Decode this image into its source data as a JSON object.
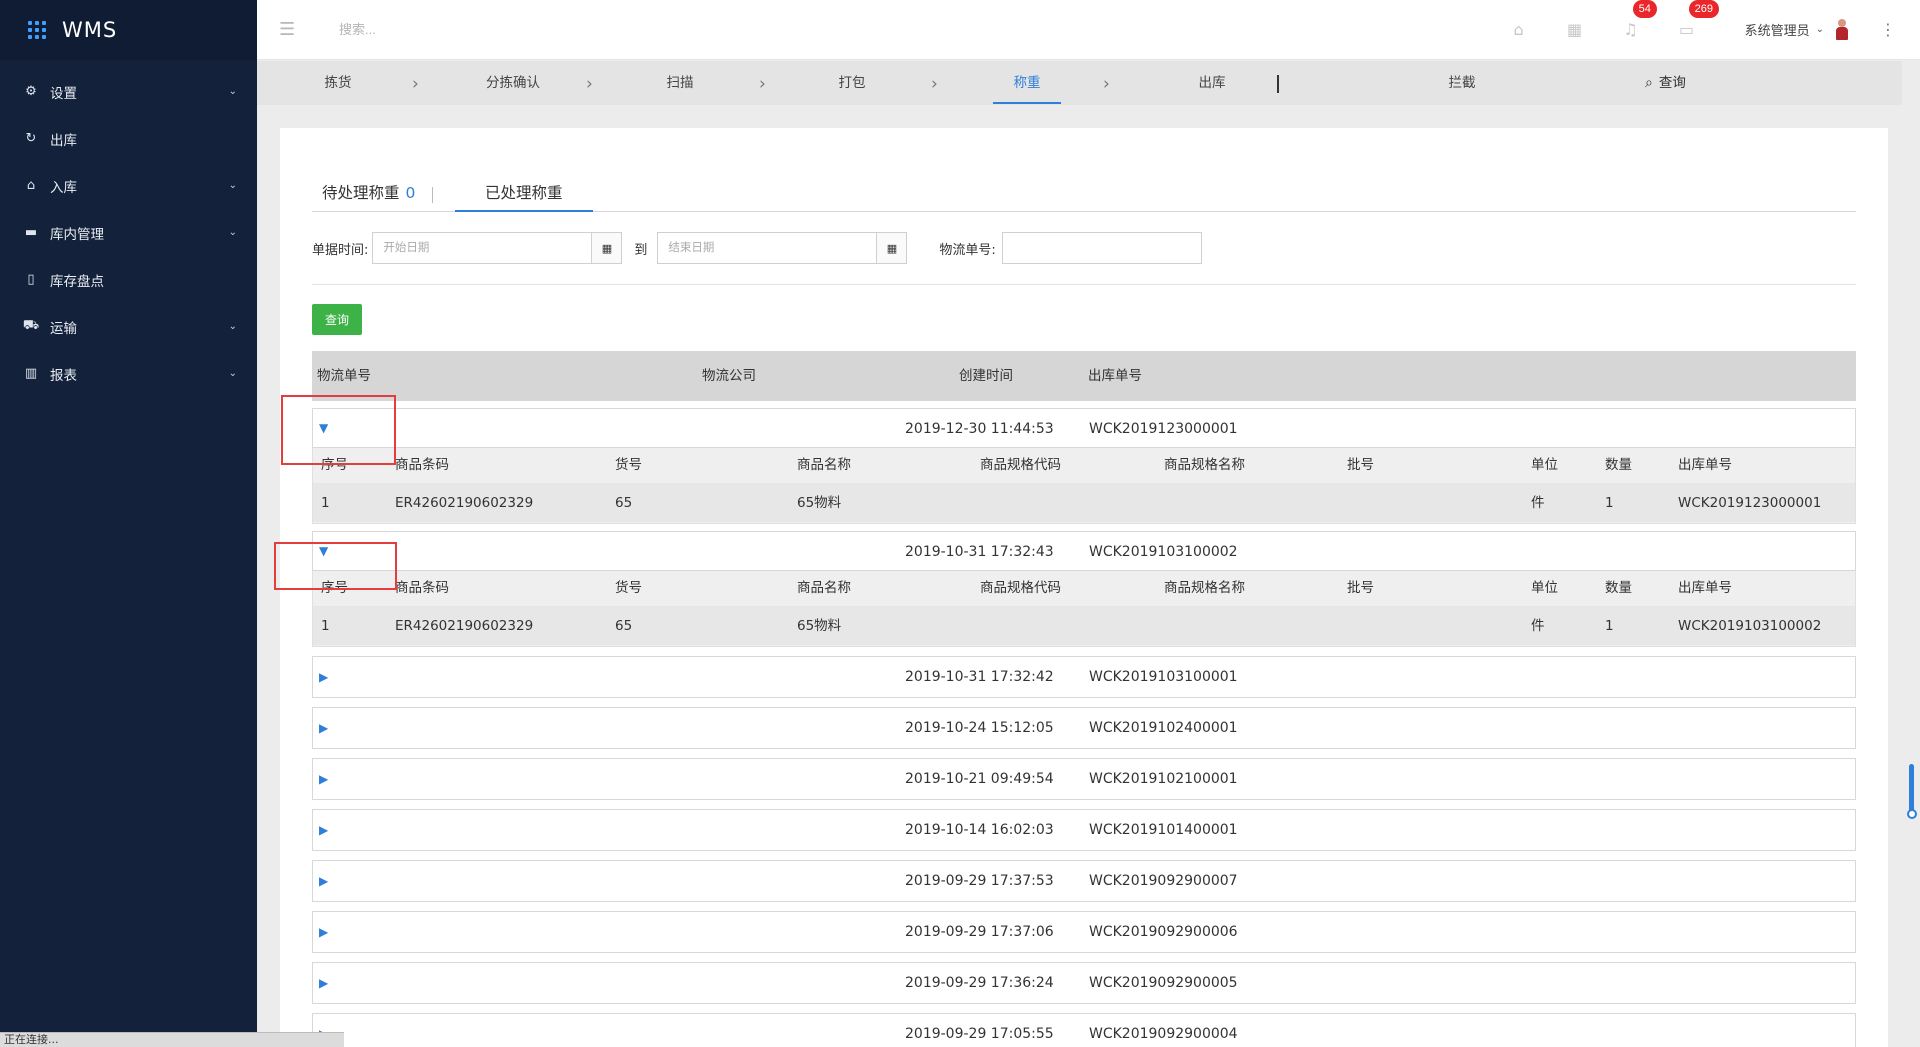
{
  "app": {
    "title": "WMS"
  },
  "sidebar": {
    "items": [
      {
        "label": "设置",
        "icon": "gear-icon",
        "has_children": true
      },
      {
        "label": "出库",
        "icon": "refresh-icon",
        "has_children": false
      },
      {
        "label": "入库",
        "icon": "home-icon",
        "has_children": true
      },
      {
        "label": "库内管理",
        "icon": "archive-icon",
        "has_children": true
      },
      {
        "label": "库存盘点",
        "icon": "document-icon",
        "has_children": false
      },
      {
        "label": "运输",
        "icon": "truck-icon",
        "has_children": true
      },
      {
        "label": "报表",
        "icon": "bar-chart-icon",
        "has_children": true
      }
    ]
  },
  "status_bar": {
    "text": "正在连接..."
  },
  "header": {
    "search_placeholder": "搜索...",
    "notifications_count": "54",
    "messages_count": "269",
    "user_name": "系统管理员"
  },
  "steps": {
    "items": [
      "拣货",
      "分拣确认",
      "扫描",
      "打包",
      "称重",
      "出库",
      "拦截"
    ],
    "active": "称重",
    "search_label": "查询"
  },
  "tabs": {
    "pending_label": "待处理称重",
    "pending_count": "0",
    "done_label": "已处理称重"
  },
  "filter": {
    "date_label": "单据时间:",
    "start_placeholder": "开始日期",
    "to_label": "到",
    "end_placeholder": "结束日期",
    "tracking_label": "物流单号:",
    "tracking_value": "",
    "query_label": "查询"
  },
  "table": {
    "headers": [
      "物流单号",
      "物流公司",
      "创建时间",
      "出库单号"
    ],
    "detail_headers": [
      "序号",
      "商品条码",
      "货号",
      "商品名称",
      "商品规格代码",
      "商品规格名称",
      "批号",
      "单位",
      "数量",
      "出库单号"
    ],
    "rows": [
      {
        "tracking": "",
        "company": "",
        "created": "2019-12-30 11:44:53",
        "order": "WCK2019123000001",
        "expanded": true,
        "details": [
          {
            "seq": "1",
            "barcode": "ER42602190602329",
            "sku": "65",
            "name": "65物料",
            "spec_code": "",
            "spec_name": "",
            "batch": "",
            "unit": "件",
            "qty": "1",
            "order": "WCK2019123000001"
          }
        ]
      },
      {
        "tracking": "",
        "company": "",
        "created": "2019-10-31 17:32:43",
        "order": "WCK2019103100002",
        "expanded": true,
        "details": [
          {
            "seq": "1",
            "barcode": "ER42602190602329",
            "sku": "65",
            "name": "65物料",
            "spec_code": "",
            "spec_name": "",
            "batch": "",
            "unit": "件",
            "qty": "1",
            "order": "WCK2019103100002"
          }
        ]
      },
      {
        "tracking": "",
        "company": "",
        "created": "2019-10-31 17:32:42",
        "order": "WCK2019103100001",
        "expanded": false
      },
      {
        "tracking": "",
        "company": "",
        "created": "2019-10-24 15:12:05",
        "order": "WCK2019102400001",
        "expanded": false
      },
      {
        "tracking": "",
        "company": "",
        "created": "2019-10-21 09:49:54",
        "order": "WCK2019102100001",
        "expanded": false
      },
      {
        "tracking": "",
        "company": "",
        "created": "2019-10-14 16:02:03",
        "order": "WCK2019101400001",
        "expanded": false
      },
      {
        "tracking": "",
        "company": "",
        "created": "2019-09-29 17:37:53",
        "order": "WCK2019092900007",
        "expanded": false
      },
      {
        "tracking": "",
        "company": "",
        "created": "2019-09-29 17:37:06",
        "order": "WCK2019092900006",
        "expanded": false
      },
      {
        "tracking": "",
        "company": "",
        "created": "2019-09-29 17:36:24",
        "order": "WCK2019092900005",
        "expanded": false
      },
      {
        "tracking": "",
        "company": "",
        "created": "2019-09-29 17:05:55",
        "order": "WCK2019092900004",
        "expanded": false
      }
    ]
  },
  "colors": {
    "sidebar_bg": "#13213a",
    "accent": "#2f7fd9",
    "query_button": "#3db246",
    "badge": "#e9262a",
    "highlight_box": "#e43d3d"
  }
}
